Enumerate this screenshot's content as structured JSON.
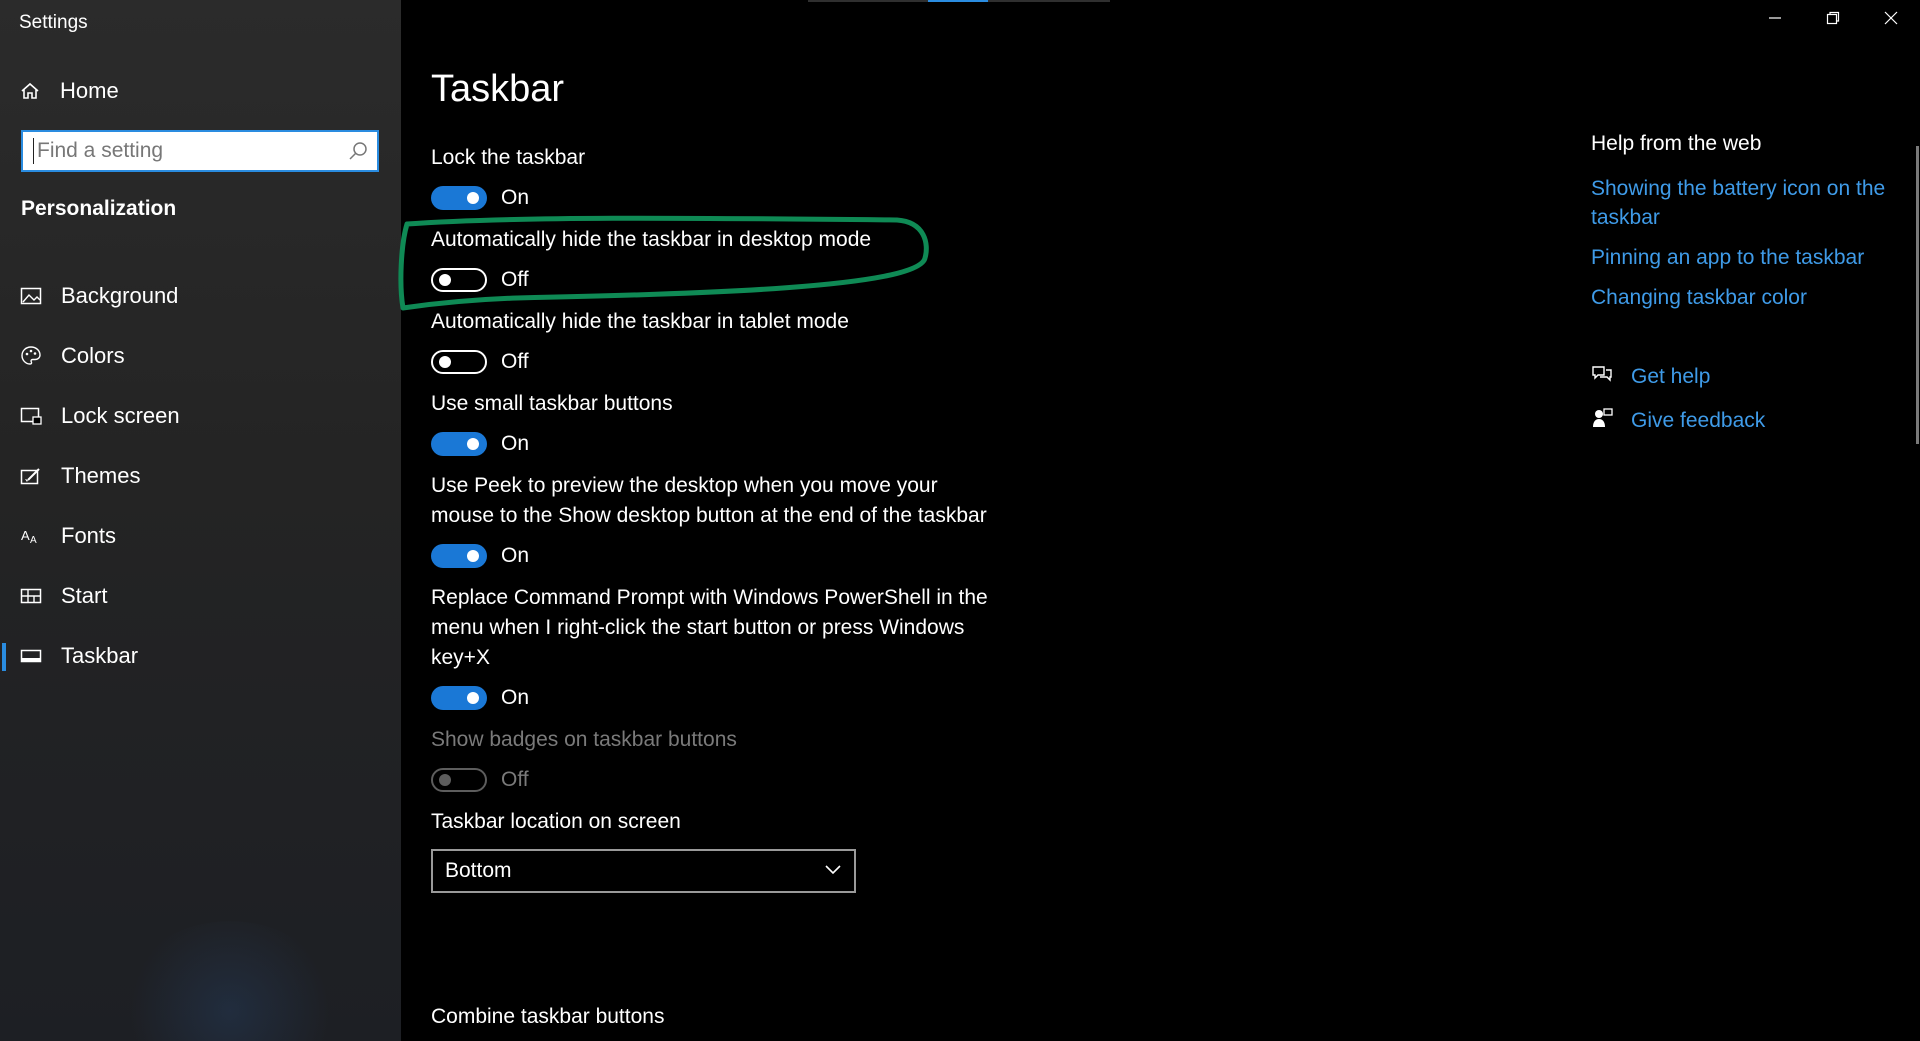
{
  "window": {
    "title": "Settings"
  },
  "sidebar": {
    "home_label": "Home",
    "search_placeholder": "Find a setting",
    "section_title": "Personalization",
    "items": [
      {
        "label": "Background",
        "icon": "picture-icon",
        "active": false
      },
      {
        "label": "Colors",
        "icon": "palette-icon",
        "active": false
      },
      {
        "label": "Lock screen",
        "icon": "lock-screen-icon",
        "active": false
      },
      {
        "label": "Themes",
        "icon": "themes-icon",
        "active": false
      },
      {
        "label": "Fonts",
        "icon": "fonts-icon",
        "active": false
      },
      {
        "label": "Start",
        "icon": "start-icon",
        "active": false
      },
      {
        "label": "Taskbar",
        "icon": "taskbar-icon",
        "active": true
      }
    ]
  },
  "main": {
    "title": "Taskbar",
    "settings": [
      {
        "label": "Lock the taskbar",
        "state": "On"
      },
      {
        "label": "Automatically hide the taskbar in desktop mode",
        "state": "Off"
      },
      {
        "label": "Automatically hide the taskbar in tablet mode",
        "state": "Off"
      },
      {
        "label": "Use small taskbar buttons",
        "state": "On"
      },
      {
        "label": "Use Peek to preview the desktop when you move your mouse to the Show desktop button at the end of the taskbar",
        "state": "On"
      },
      {
        "label": "Replace Command Prompt with Windows PowerShell in the menu when I right-click the start button or press Windows key+X",
        "state": "On"
      },
      {
        "label": "Show badges on taskbar buttons",
        "state": "Off"
      }
    ],
    "location_label": "Taskbar location on screen",
    "location_value": "Bottom",
    "combine_label": "Combine taskbar buttons"
  },
  "help": {
    "title": "Help from the web",
    "links": [
      "Showing the battery icon on the taskbar",
      "Pinning an app to the taskbar",
      "Changing taskbar color"
    ],
    "get_help": "Get help",
    "give_feedback": "Give feedback"
  },
  "colors": {
    "accent": "#1a78d6",
    "link": "#3f9be8",
    "highlight": "#0f8a55"
  }
}
